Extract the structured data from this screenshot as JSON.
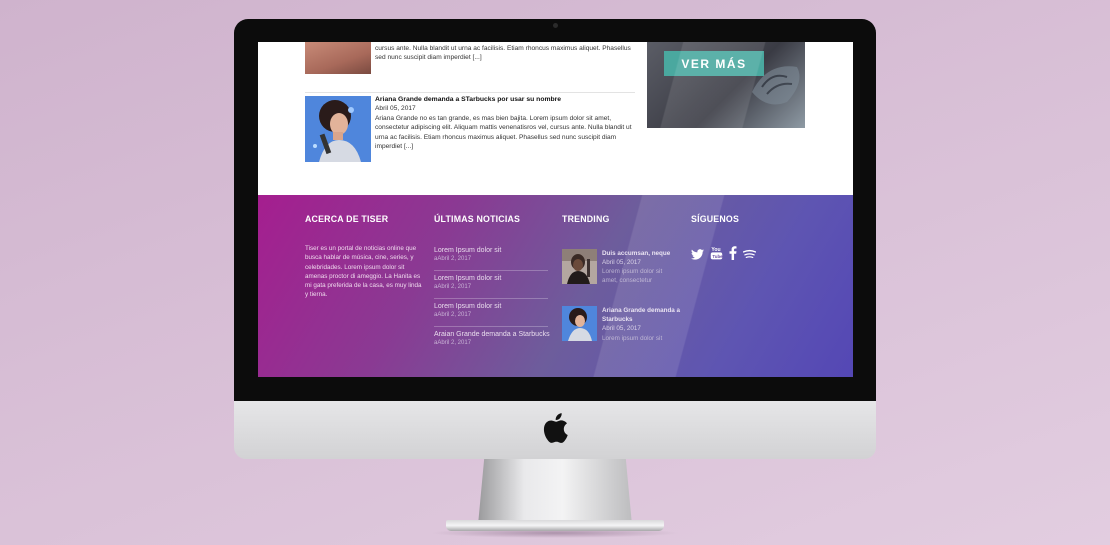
{
  "top_article": {
    "excerpt": "cursus ante. Nulla blandit ut urna ac facilisis. Etiam rhoncus maximus aliquet. Phasellus sed nunc suscipit diam imperdiet [...]"
  },
  "article": {
    "title": "Ariana Grande demanda a STarbucks por usar su nombre",
    "date": "Abril 05, 2017",
    "excerpt": "Ariana Grande no es tan grande, es mas bien bajita. Lorem ipsum dolor sit amet, consectetur adipiscing elit. Aliquam mattis venenatisros vel, cursus ante. Nulla blandit ut urna ac facilisis. Etiam rhoncus maximus aliquet. Phasellus sed nunc suscipit diam imperdiet [...]"
  },
  "promo": {
    "button_label": "VER MÁS"
  },
  "footer": {
    "about": {
      "heading": "ACERCA DE TISER",
      "text": "Tiser es un portal de noticias online que busca hablar de música, cine, series, y celebridades. Lorem ipsum dolor sit amenas proctor di ameggio. La Hanita es mi gata preferida de la casa, es muy linda y tierna."
    },
    "news": {
      "heading": "ÚLTIMAS NOTICIAS",
      "items": [
        {
          "title": "Lorem Ipsum dolor sit",
          "date": "aAbril 2, 2017"
        },
        {
          "title": "Lorem Ipsum dolor sit",
          "date": "aAbril 2, 2017"
        },
        {
          "title": "Lorem Ipsum dolor sit",
          "date": "aAbril 2, 2017"
        },
        {
          "title": "Araian Grande demanda a Starbucks",
          "date": "aAbril 2, 2017"
        }
      ]
    },
    "trending": {
      "heading": "TRENDING",
      "items": [
        {
          "title": "Duis accumsan, neque",
          "date": "Abril 05, 2017",
          "excerpt": "Lorem ipsum dolor sit amet, consectetur"
        },
        {
          "title": "Ariana Grande demanda a Starbucks",
          "date": "Abril 05, 2017",
          "excerpt": "Lorem ipsum dolor sit"
        }
      ]
    },
    "social": {
      "heading": "SÍGUENOS",
      "icons": [
        "twitter-icon",
        "youtube-icon",
        "facebook-icon",
        "spotify-icon"
      ]
    }
  },
  "colors": {
    "footer_gradient_start": "#a51e8f",
    "footer_gradient_end": "#5447b5",
    "button_teal": "#4aa89f"
  }
}
